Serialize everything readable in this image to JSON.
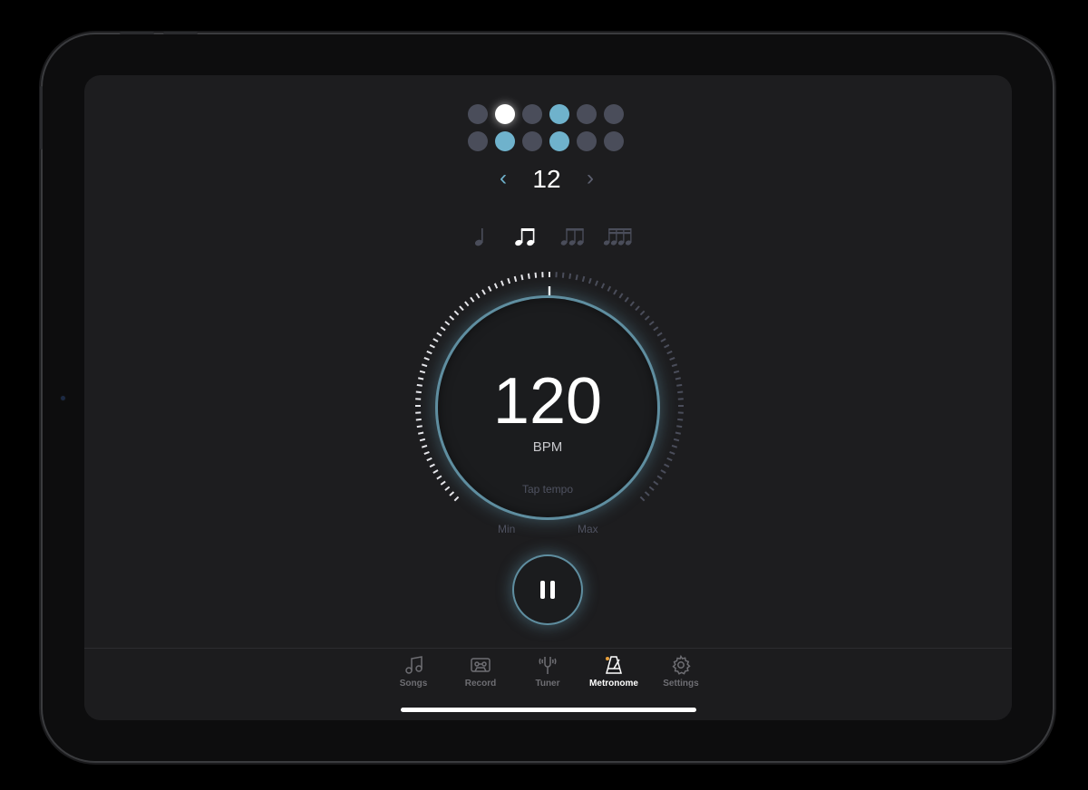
{
  "beat_grid": {
    "beats": [
      {
        "state": "off"
      },
      {
        "state": "current"
      },
      {
        "state": "off"
      },
      {
        "state": "accent"
      },
      {
        "state": "off"
      },
      {
        "state": "off"
      },
      {
        "state": "off"
      },
      {
        "state": "accent"
      },
      {
        "state": "off"
      },
      {
        "state": "accent"
      },
      {
        "state": "off"
      },
      {
        "state": "off"
      }
    ],
    "colors": {
      "off": "#4a4d5a",
      "accent": "#6fb2cc",
      "current": "#ffffff"
    }
  },
  "stepper": {
    "value": "12",
    "prev_icon": "chevron-left-icon",
    "next_icon": "chevron-right-icon",
    "prev_glyph": "‹",
    "next_glyph": "›"
  },
  "subdivisions": [
    {
      "name": "quarter-note",
      "selected": false
    },
    {
      "name": "eighth-notes",
      "selected": true
    },
    {
      "name": "eighth-notes-alt",
      "selected": false
    },
    {
      "name": "sixteenth-notes",
      "selected": false
    }
  ],
  "tempo": {
    "value": "120",
    "unit": "BPM",
    "tap_label": "Tap tempo",
    "min_label": "Min",
    "max_label": "Max",
    "level_fraction": 0.5
  },
  "transport": {
    "state": "playing",
    "icon": "pause-icon"
  },
  "tabs": [
    {
      "label": "Songs",
      "icon": "music-note-icon",
      "active": false
    },
    {
      "label": "Record",
      "icon": "cassette-icon",
      "active": false
    },
    {
      "label": "Tuner",
      "icon": "tuning-fork-icon",
      "active": false
    },
    {
      "label": "Metronome",
      "icon": "metronome-icon",
      "active": true
    },
    {
      "label": "Settings",
      "icon": "gear-icon",
      "active": false
    }
  ],
  "colors": {
    "accent": "#6fb2cc",
    "background": "#1d1d1f",
    "inactive": "#6e6e73",
    "metronome_icon_accent": "#e8a03a"
  }
}
